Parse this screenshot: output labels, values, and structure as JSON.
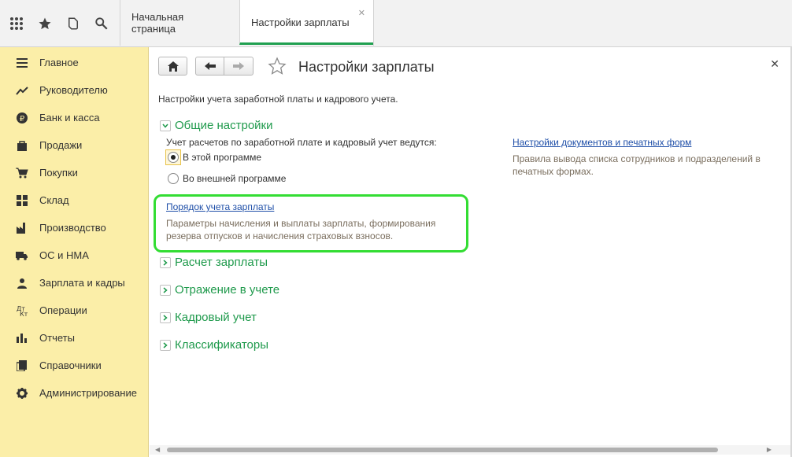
{
  "tabs": [
    {
      "label": "Начальная страница"
    },
    {
      "label": "Настройки зарплаты"
    }
  ],
  "sidebar": {
    "items": [
      {
        "label": "Главное",
        "icon": "menu-icon"
      },
      {
        "label": "Руководителю",
        "icon": "trend-icon"
      },
      {
        "label": "Банк и касса",
        "icon": "ruble-icon"
      },
      {
        "label": "Продажи",
        "icon": "bag-icon"
      },
      {
        "label": "Покупки",
        "icon": "cart-icon"
      },
      {
        "label": "Склад",
        "icon": "warehouse-icon"
      },
      {
        "label": "Производство",
        "icon": "factory-icon"
      },
      {
        "label": "ОС и НМА",
        "icon": "truck-icon"
      },
      {
        "label": "Зарплата и кадры",
        "icon": "people-icon"
      },
      {
        "label": "Операции",
        "icon": "debit-credit-icon"
      },
      {
        "label": "Отчеты",
        "icon": "bar-chart-icon"
      },
      {
        "label": "Справочники",
        "icon": "book-icon"
      },
      {
        "label": "Администрирование",
        "icon": "gear-icon"
      }
    ]
  },
  "main": {
    "title": "Настройки зарплаты",
    "intro": "Настройки учета заработной платы и кадрового учета.",
    "general": {
      "label": "Общие настройки",
      "question": "Учет расчетов по заработной плате и кадровый учет ведутся:",
      "options": [
        "В этой программе",
        "Во внешней программе"
      ],
      "selected": "В этой программе",
      "order_link": "Порядок учета зарплаты",
      "order_desc_1": "Параметры начисления и выплаты зарплаты, формирования",
      "order_desc_2": "резерва отпусков и начисления страховых взносов.",
      "docs_link": "Настройки документов и печатных форм",
      "docs_desc_1": "Правила вывода списка сотрудников и подразделений в",
      "docs_desc_2": "печатных формах."
    },
    "sections": [
      "Расчет зарплаты",
      "Отражение в учете",
      "Кадровый учет",
      "Классификаторы"
    ]
  },
  "colors": {
    "sidebar_bg": "#fbeea8",
    "section_green": "#1f9a4c",
    "highlight": "#33dd33",
    "link": "#1f4fa8"
  }
}
